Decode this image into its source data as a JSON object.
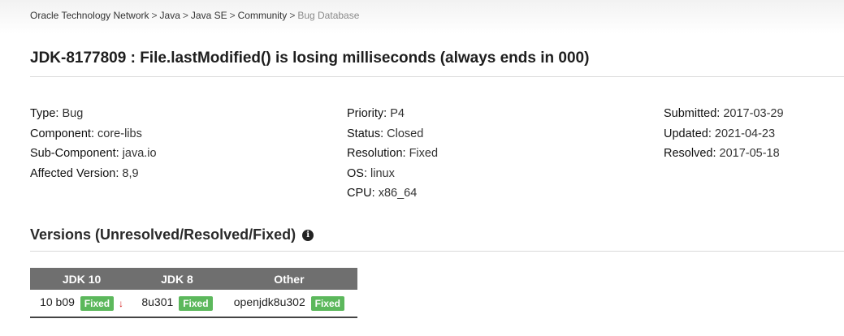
{
  "breadcrumb": {
    "items": [
      "Oracle Technology Network",
      "Java",
      "Java SE",
      "Community"
    ],
    "current": "Bug Database",
    "separator": ">"
  },
  "title": "JDK-8177809 : File.lastModified() is losing milliseconds (always ends in 000)",
  "details": {
    "left": [
      {
        "label": "Type:",
        "value": "Bug"
      },
      {
        "label": "Component:",
        "value": "core-libs"
      },
      {
        "label": "Sub-Component:",
        "value": "java.io"
      },
      {
        "label": "Affected Version:",
        "value": "8,9"
      }
    ],
    "middle": [
      {
        "label": "Priority:",
        "value": "P4"
      },
      {
        "label": "Status:",
        "value": "Closed"
      },
      {
        "label": "Resolution:",
        "value": "Fixed"
      },
      {
        "label": "OS:",
        "value": "linux"
      },
      {
        "label": "CPU:",
        "value": "x86_64"
      }
    ],
    "right": [
      {
        "label": "Submitted:",
        "value": "2017-03-29"
      },
      {
        "label": "Updated:",
        "value": "2021-04-23"
      },
      {
        "label": "Resolved:",
        "value": "2017-05-18"
      }
    ]
  },
  "versions": {
    "title": "Versions (Unresolved/Resolved/Fixed)",
    "info_icon": "info-circle-icon",
    "headers": [
      "JDK 10",
      "JDK 8",
      "Other"
    ],
    "cells": [
      {
        "version": "10 b09",
        "status": "Fixed",
        "arrow": "↓"
      },
      {
        "version": "8u301",
        "status": "Fixed"
      },
      {
        "version": "openjdk8u302",
        "status": "Fixed"
      }
    ]
  },
  "colors": {
    "badge": "#5cb85c",
    "table_header": "#6f6f6f",
    "arrow": "#d21b1b"
  }
}
